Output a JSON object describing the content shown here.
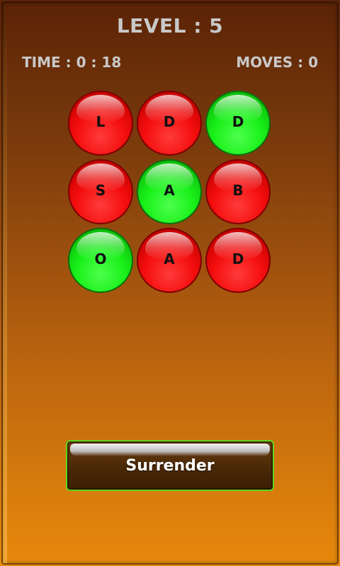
{
  "header": {
    "level_text": "LEVEL : 5",
    "time_text": "TIME : 0 : 18",
    "moves_text": "MOVES : 0"
  },
  "board": {
    "cells": [
      {
        "letter": "L",
        "color": "red"
      },
      {
        "letter": "D",
        "color": "red"
      },
      {
        "letter": "D",
        "color": "green"
      },
      {
        "letter": "S",
        "color": "red"
      },
      {
        "letter": "A",
        "color": "green"
      },
      {
        "letter": "B",
        "color": "red"
      },
      {
        "letter": "O",
        "color": "green"
      },
      {
        "letter": "A",
        "color": "red"
      },
      {
        "letter": "D",
        "color": "red"
      }
    ]
  },
  "actions": {
    "surrender_label": "Surrender"
  },
  "colors": {
    "red": "#f40e0e",
    "green": "#19f019",
    "button_border": "#5fd41c",
    "text_muted": "#c9c9c9"
  }
}
